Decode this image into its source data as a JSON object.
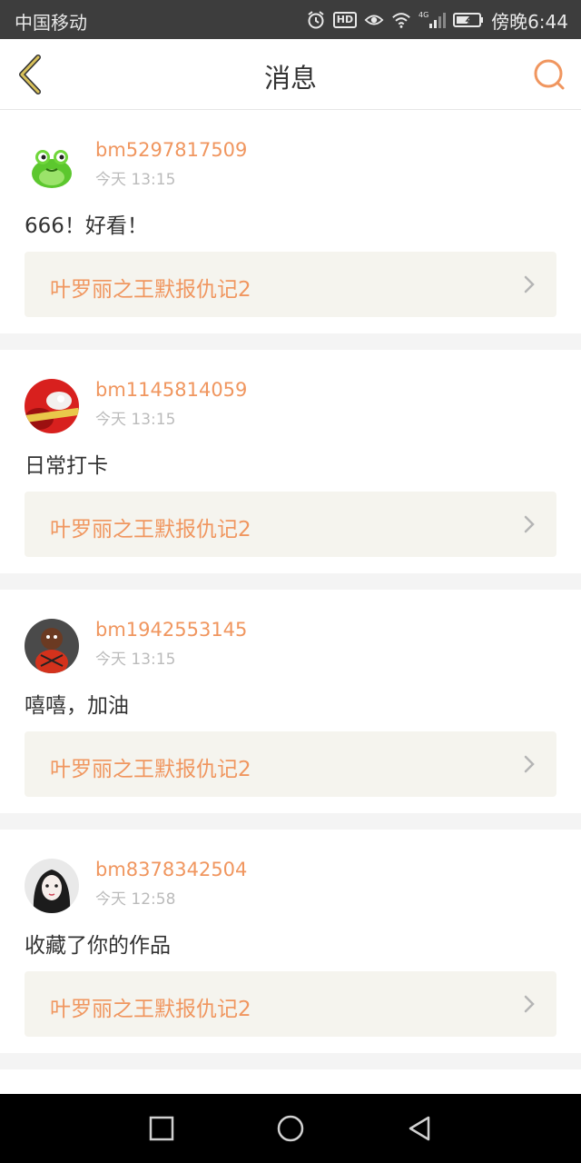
{
  "status_bar": {
    "carrier": "中国移动",
    "network": "4G",
    "hd": "HD",
    "time": "傍晚6:44"
  },
  "header": {
    "title": "消息",
    "back_icon": "chevron-left-icon",
    "search_icon": "search-icon"
  },
  "colors": {
    "accent": "#f0965f",
    "work_bg": "#f5f4ee"
  },
  "messages": [
    {
      "username": "bm5297817509",
      "time": "今天 13:15",
      "content": "666！好看！",
      "work_title": "叶罗丽之王默报仇记2"
    },
    {
      "username": "bm1145814059",
      "time": "今天 13:15",
      "content": "日常打卡",
      "work_title": "叶罗丽之王默报仇记2"
    },
    {
      "username": "bm1942553145",
      "time": "今天 13:15",
      "content": "嘻嘻，加油",
      "work_title": "叶罗丽之王默报仇记2"
    },
    {
      "username": "bm8378342504",
      "time": "今天 12:58",
      "content": "收藏了你的作品",
      "work_title": "叶罗丽之王默报仇记2"
    }
  ],
  "system_nav": [
    "square-icon",
    "circle-icon",
    "triangle-back-icon"
  ]
}
